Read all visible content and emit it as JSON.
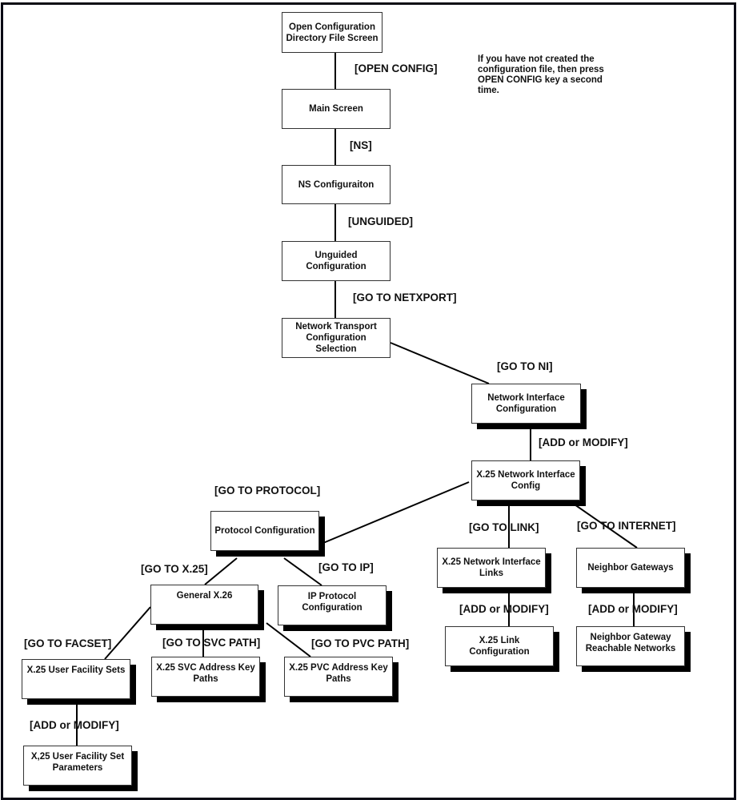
{
  "nodes": {
    "open_config_dir": "Open Configuration Directory File Screen",
    "main_screen": "Main Screen",
    "ns_config": "NS Configuraiton",
    "unguided_config": "Unguided Configuration",
    "network_transport": "Network Transport Configuration Selection",
    "network_interface": "Network Interface Configuration",
    "x25_ni_config": "X.25 Network Interface Config",
    "protocol_config": "Protocol Configuration",
    "x25_ni_links": "X.25 Network Interface Links",
    "neighbor_gateways": "Neighbor Gateways",
    "general_x26": "General X.26",
    "ip_protocol_config": "IP Protocol Configuration",
    "x25_link_config": "X.25 Link Configuration",
    "neighbor_gateway_reachable": "Neighbor Gateway Reachable Networks",
    "x25_user_facility_sets": "X.25 User Facility Sets",
    "x25_svc_address": "X.25 SVC Address Key Paths",
    "x25_pvc_address": "X.25 PVC Address Key Paths",
    "x25_user_facility_params": "X,25 User Facility Set Parameters"
  },
  "edges": {
    "open_config": "[OPEN CONFIG]",
    "ns": "[NS]",
    "unguided": "[UNGUIDED]",
    "go_to_netxport": "[GO TO NETXPORT]",
    "go_to_ni": "[GO TO NI]",
    "add_or_modify_ni": "[ADD or MODIFY]",
    "go_to_protocol": "[GO TO PROTOCOL]",
    "go_to_link": "[GO TO LINK]",
    "go_to_internet": "[GO TO INTERNET]",
    "go_to_x25": "[GO TO X.25]",
    "go_to_ip": "[GO TO IP]",
    "add_or_modify_link": "[ADD or MODIFY]",
    "add_or_modify_gateway": "[ADD or MODIFY]",
    "go_to_facset": "[GO TO FACSET]",
    "go_to_svc_path": "[GO TO SVC PATH]",
    "go_to_pvc_path": "[GO TO PVC PATH]",
    "add_or_modify_facset": "[ADD or MODIFY]"
  },
  "note": "If you have not created the configuration file, then press OPEN CONFIG key a second time."
}
